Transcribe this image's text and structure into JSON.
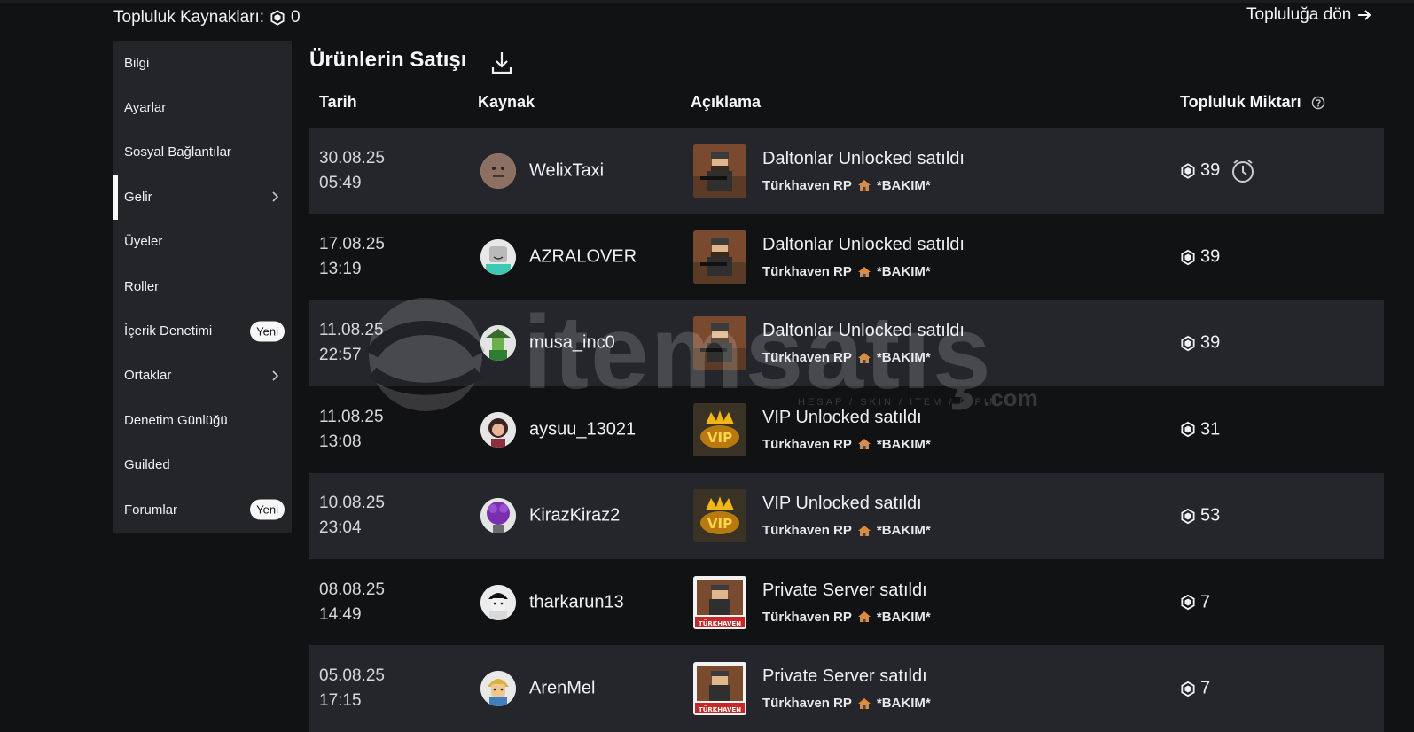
{
  "header": {
    "resources_label": "Topluluk Kaynakları:",
    "resources_value": "0",
    "back_link": "Topluluğa dön"
  },
  "sidebar": {
    "items": [
      {
        "label": "Bilgi"
      },
      {
        "label": "Ayarlar"
      },
      {
        "label": "Sosyal Bağlantılar"
      },
      {
        "label": "Gelir",
        "active": true,
        "chevron": true
      },
      {
        "label": "Üyeler"
      },
      {
        "label": "Roller"
      },
      {
        "label": "İçerik Denetimi",
        "badge": "Yeni"
      },
      {
        "label": "Ortaklar",
        "chevron": true
      },
      {
        "label": "Denetim Günlüğü"
      },
      {
        "label": "Guilded"
      },
      {
        "label": "Forumlar",
        "badge": "Yeni"
      }
    ]
  },
  "main": {
    "title": "Ürünlerin Satışı",
    "columns": {
      "date": "Tarih",
      "source": "Kaynak",
      "description": "Açıklama",
      "amount": "Topluluk Miktarı"
    },
    "rows": [
      {
        "date": "30.08.25",
        "time": "05:49",
        "user": "WelixTaxi",
        "title": "Daltonlar Unlocked satıldı",
        "game": "Türkhaven RP",
        "tag": "*BAKIM*",
        "amount": "39",
        "pending": true,
        "thumb": "soldier",
        "avatar": "smiley"
      },
      {
        "date": "17.08.25",
        "time": "13:19",
        "user": "AZRALOVER",
        "title": "Daltonlar Unlocked satıldı",
        "game": "Türkhaven RP",
        "tag": "*BAKIM*",
        "amount": "39",
        "pending": false,
        "thumb": "soldier",
        "avatar": "grey"
      },
      {
        "date": "11.08.25",
        "time": "22:57",
        "user": "musa_inc0",
        "title": "Daltonlar Unlocked satıldı",
        "game": "Türkhaven RP",
        "tag": "*BAKIM*",
        "amount": "39",
        "pending": false,
        "thumb": "soldier",
        "avatar": "green"
      },
      {
        "date": "11.08.25",
        "time": "13:08",
        "user": "aysuu_13021",
        "title": "VIP Unlocked satıldı",
        "game": "Türkhaven RP",
        "tag": "*BAKIM*",
        "amount": "31",
        "pending": false,
        "thumb": "vip",
        "avatar": "girl"
      },
      {
        "date": "10.08.25",
        "time": "23:04",
        "user": "KirazKiraz2",
        "title": "VIP Unlocked satıldı",
        "game": "Türkhaven RP",
        "tag": "*BAKIM*",
        "amount": "53",
        "pending": false,
        "thumb": "vip",
        "avatar": "purple"
      },
      {
        "date": "08.08.25",
        "time": "14:49",
        "user": "tharkarun13",
        "title": "Private Server satıldı",
        "game": "Türkhaven RP",
        "tag": "*BAKIM*",
        "amount": "7",
        "pending": false,
        "thumb": "server",
        "avatar": "boy"
      },
      {
        "date": "05.08.25",
        "time": "17:15",
        "user": "ArenMel",
        "title": "Private Server satıldı",
        "game": "Türkhaven RP",
        "tag": "*BAKIM*",
        "amount": "7",
        "pending": false,
        "thumb": "server",
        "avatar": "blonde"
      }
    ]
  },
  "watermark": {
    "text": "itemsatış",
    "subtext": "HESAP / SKIN / ITEM / E-PIN",
    "suffix": ".com"
  },
  "icons": {
    "currency": "robux-icon",
    "download": "download-icon",
    "help": "help-icon",
    "pending": "clock-icon",
    "chevron": "chevron-right-icon",
    "arrow": "arrow-right-icon"
  }
}
